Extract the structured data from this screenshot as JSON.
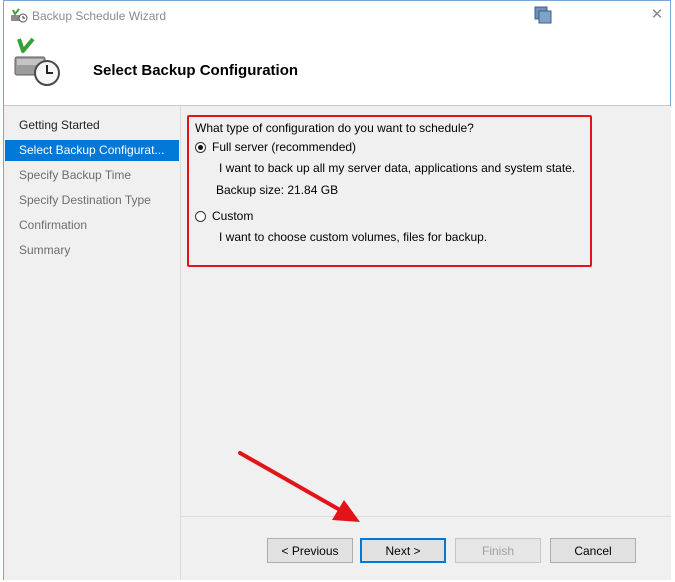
{
  "window": {
    "title": "Backup Schedule Wizard"
  },
  "header": {
    "title": "Select Backup Configuration"
  },
  "nav": {
    "items": [
      {
        "label": "Getting Started",
        "state": "done"
      },
      {
        "label": "Select Backup Configurat...",
        "state": "current"
      },
      {
        "label": "Specify Backup Time",
        "state": "future"
      },
      {
        "label": "Specify Destination Type",
        "state": "future"
      },
      {
        "label": "Confirmation",
        "state": "future"
      },
      {
        "label": "Summary",
        "state": "future"
      }
    ]
  },
  "content": {
    "question": "What type of configuration do you want to schedule?",
    "options": [
      {
        "label": "Full server (recommended)",
        "selected": true,
        "description": "I want to back up all my server data, applications and system state.",
        "detail": "Backup size: 21.84 GB"
      },
      {
        "label": "Custom",
        "selected": false,
        "description": "I want to choose custom volumes, files for backup."
      }
    ]
  },
  "footer": {
    "previous_label": "< Previous",
    "next_label": "Next >",
    "finish_label": "Finish",
    "cancel_label": "Cancel"
  },
  "colors": {
    "accent": "#0078d7",
    "annotation_red": "#e2141a",
    "panel_bg": "#f0f0f0"
  },
  "icons": {
    "app": "backup-wizard-icon",
    "header": "backup-drive-clock-icon",
    "window_stack": "window-stack-icon",
    "close": "close-icon"
  }
}
